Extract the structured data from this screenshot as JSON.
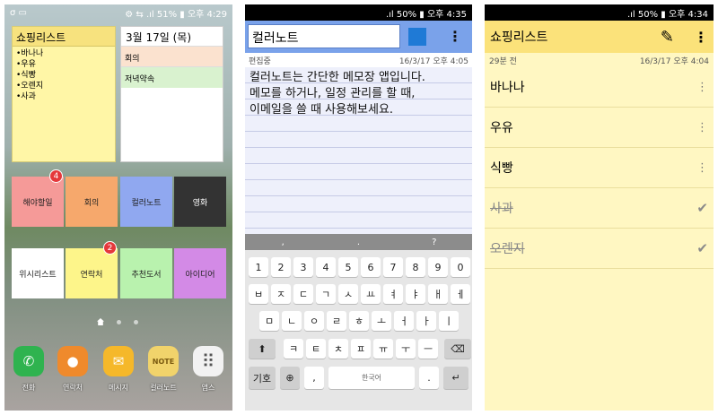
{
  "home": {
    "status": {
      "left": "σ ▭",
      "right": "⚙ ⇆ .ıl 51% ▮ 오후 4:29"
    },
    "memo_widget": {
      "title": "쇼핑리스트",
      "items": [
        "•바나나",
        "•우유",
        "•식빵",
        "•오렌지",
        "•사과"
      ]
    },
    "calendar_widget": {
      "date": "3월 17일 (목)",
      "events": [
        "회의",
        "저녁약속"
      ]
    },
    "tiles": [
      {
        "label": "해야할일",
        "color": "#f59a98",
        "badge": "4"
      },
      {
        "label": "회의",
        "color": "#f6a86c",
        "badge": ""
      },
      {
        "label": "컬러노트",
        "color": "#90a8f0",
        "badge": ""
      },
      {
        "label": "영화",
        "color": "#333333",
        "badge": ""
      },
      {
        "label": "위시리스트",
        "color": "#ffffff",
        "badge": ""
      },
      {
        "label": "연락처",
        "color": "#fdf58a",
        "badge": "2"
      },
      {
        "label": "추천도서",
        "color": "#b9f2ae",
        "badge": ""
      },
      {
        "label": "아이디어",
        "color": "#d38ae6",
        "badge": ""
      }
    ],
    "dock": [
      {
        "label": "전화",
        "icon": "phone-icon",
        "glyph": "✆",
        "color": "#2fb34f"
      },
      {
        "label": "연락처",
        "icon": "contacts-icon",
        "glyph": "●",
        "color": "#ef8a2c"
      },
      {
        "label": "메시지",
        "icon": "message-icon",
        "glyph": "✉",
        "color": "#f5b82a"
      },
      {
        "label": "컬러노트",
        "icon": "colornote-icon",
        "glyph": "NOTE",
        "color": "#f1d36b"
      },
      {
        "label": "앱스",
        "icon": "apps-icon",
        "glyph": "⠿",
        "color": "#f2f2f2"
      }
    ]
  },
  "editor": {
    "status": {
      "right": ".ıl 50% ▮ 오후 4:35"
    },
    "title": "컬러노트",
    "color_hex": "#1f7ad6",
    "menu": "⋮",
    "mode": "편집중",
    "timestamp": "16/3/17 오후 4:05",
    "body": "컬러노트는 간단한 메모장 앱입니다.\n메모를 하거나, 일정 관리를 할 때,\n이메일을 쓸 때 사용해보세요.",
    "kb_top": [
      ",",
      ".",
      "?"
    ],
    "rows": [
      [
        "1",
        "2",
        "3",
        "4",
        "5",
        "6",
        "7",
        "8",
        "9",
        "0"
      ],
      [
        "ㅂ",
        "ㅈ",
        "ㄷ",
        "ㄱ",
        "ㅅ",
        "ㅛ",
        "ㅕ",
        "ㅑ",
        "ㅐ",
        "ㅔ"
      ],
      [
        "ㅁ",
        "ㄴ",
        "ㅇ",
        "ㄹ",
        "ㅎ",
        "ㅗ",
        "ㅓ",
        "ㅏ",
        "ㅣ"
      ],
      [
        "⬆",
        "ㅋ",
        "ㅌ",
        "ㅊ",
        "ㅍ",
        "ㅠ",
        "ㅜ",
        "ㅡ",
        "⌫"
      ]
    ],
    "bottom": {
      "sym": "기호",
      "globe": "⊕",
      "comma": ",",
      "space": "한국어",
      "period": ".",
      "enter": "↵"
    }
  },
  "list": {
    "status": {
      "right": ".ıl 50% ▮ 오후 4:34"
    },
    "title": "쇼핑리스트",
    "edit_icon": "✎",
    "menu": "⋮",
    "ago": "29분 전",
    "timestamp": "16/3/17 오후 4:04",
    "items": [
      {
        "label": "바나나",
        "done": false
      },
      {
        "label": "우유",
        "done": false
      },
      {
        "label": "식빵",
        "done": false
      },
      {
        "label": "사과",
        "done": true
      },
      {
        "label": "오렌지",
        "done": true
      }
    ],
    "more_glyph": "⋮",
    "check_glyph": "✔"
  }
}
